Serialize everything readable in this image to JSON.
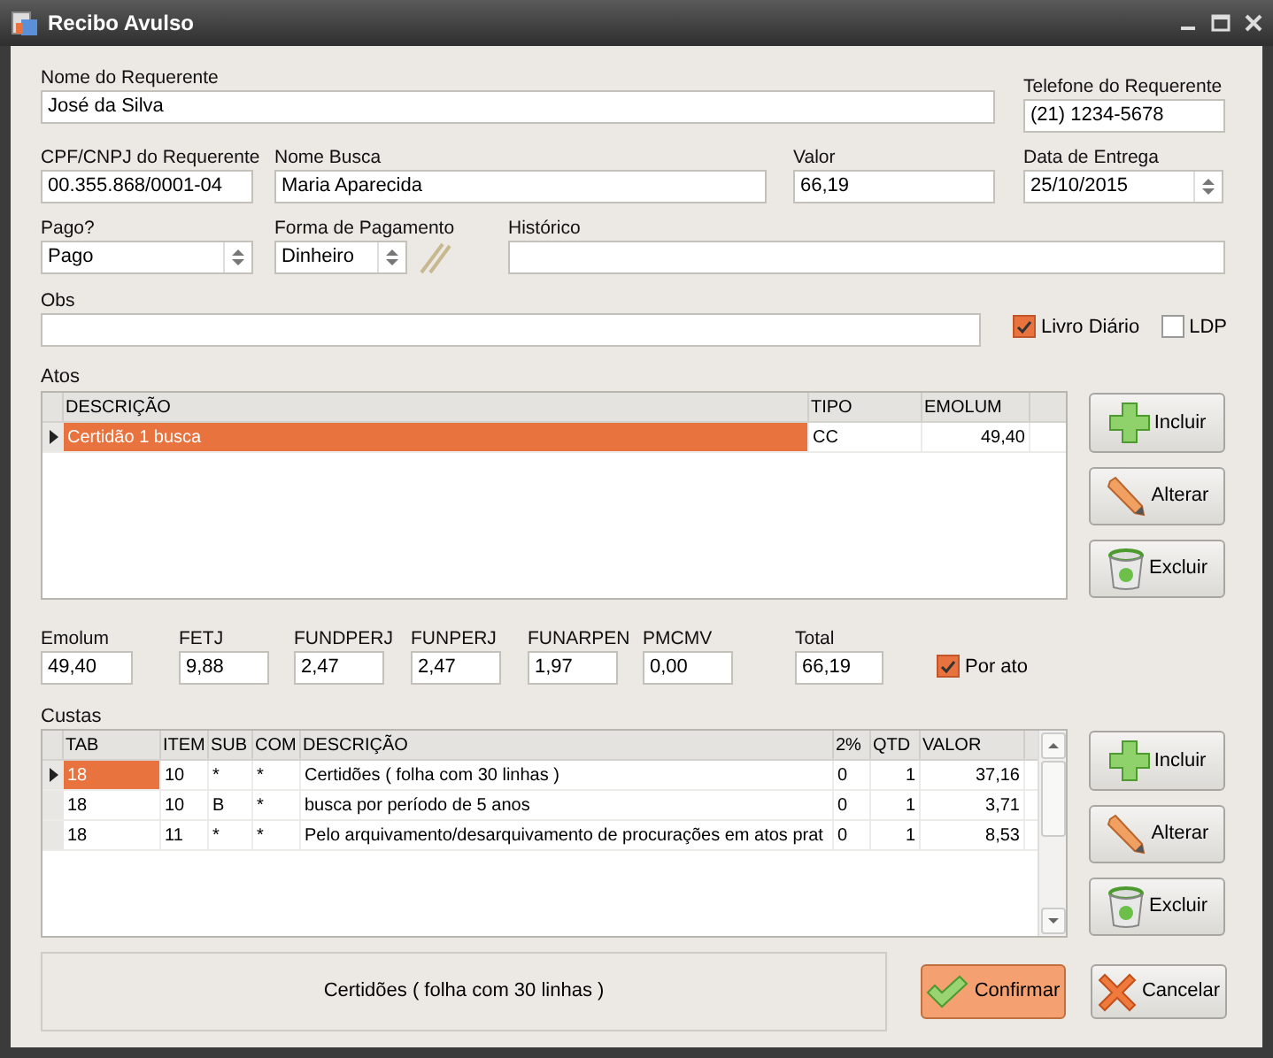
{
  "window": {
    "title": "Recibo Avulso"
  },
  "fields": {
    "nome": {
      "label": "Nome do Requerente",
      "value": "José da Silva",
      "kind": "text"
    },
    "telefone": {
      "label": "Telefone do Requerente",
      "value": "(21) 1234-5678",
      "kind": "text"
    },
    "cpf": {
      "label": "CPF/CNPJ do Requerente",
      "value": "00.355.868/0001-04",
      "kind": "text"
    },
    "nome_busca": {
      "label": "Nome Busca",
      "value": "Maria Aparecida",
      "kind": "text"
    },
    "valor": {
      "label": "Valor",
      "value": "66,19",
      "kind": "text"
    },
    "data_entrega": {
      "label": "Data de Entrega",
      "value": "25/10/2015",
      "kind": "spinner"
    },
    "pago": {
      "label": "Pago?",
      "value": "Pago",
      "kind": "spinner"
    },
    "forma_pagamento": {
      "label": "Forma de Pagamento",
      "value": "Dinheiro",
      "kind": "spinner"
    },
    "historico": {
      "label": "Histórico",
      "kind": "text"
    },
    "obs": {
      "label": "Obs",
      "kind": "text"
    }
  },
  "checkboxes": [
    {
      "label": "Livro Diário",
      "checked": true
    },
    {
      "label": "LDP",
      "checked": false
    }
  ],
  "atos": {
    "label": "Atos",
    "columns": [
      "DESCRIÇÃO",
      "TIPO",
      "EMOLUM"
    ],
    "rows": [
      {
        "cells": [
          "Certidão 1 busca",
          "CC",
          "49,40"
        ],
        "selected": true
      }
    ]
  },
  "atos_buttons": [
    "Incluir",
    "Alterar",
    "Excluir"
  ],
  "totals": [
    {
      "label": "Emolum",
      "value": "49,40"
    },
    {
      "label": "FETJ",
      "value": "9,88"
    },
    {
      "label": "FUNDPERJ",
      "value": "2,47"
    },
    {
      "label": "FUNPERJ",
      "value": "2,47"
    },
    {
      "label": "FUNARPEN",
      "value": "1,97"
    },
    {
      "label": "PMCMV",
      "value": "0,00"
    },
    {
      "label": "Total",
      "value": "66,19"
    }
  ],
  "por_ato": {
    "label": "Por ato",
    "checked": true
  },
  "custas": {
    "label": "Custas",
    "columns": [
      "TAB",
      "ITEM",
      "SUB",
      "COM",
      "DESCRIÇÃO",
      "2%",
      "QTD",
      "VALOR"
    ],
    "rows": [
      {
        "cells": [
          "18",
          "10",
          "*",
          "*",
          "Certidões ( folha com 30 linhas )",
          "0",
          "1",
          "37,16"
        ],
        "selected": true
      },
      {
        "cells": [
          "18",
          "10",
          "B",
          "*",
          "busca por período de 5 anos",
          "0",
          "1",
          "3,71"
        ],
        "selected": false
      },
      {
        "cells": [
          "18",
          "11",
          "*",
          "*",
          "Pelo arquivamento/desarquivamento de procurações em atos prat",
          "0",
          "1",
          "8,53"
        ],
        "selected": false
      }
    ]
  },
  "custas_buttons": [
    "Incluir",
    "Alterar",
    "Excluir"
  ],
  "status_text": "Certidões ( folha com 30 linhas )",
  "confirm": "Confirmar",
  "cancel": "Cancelar"
}
